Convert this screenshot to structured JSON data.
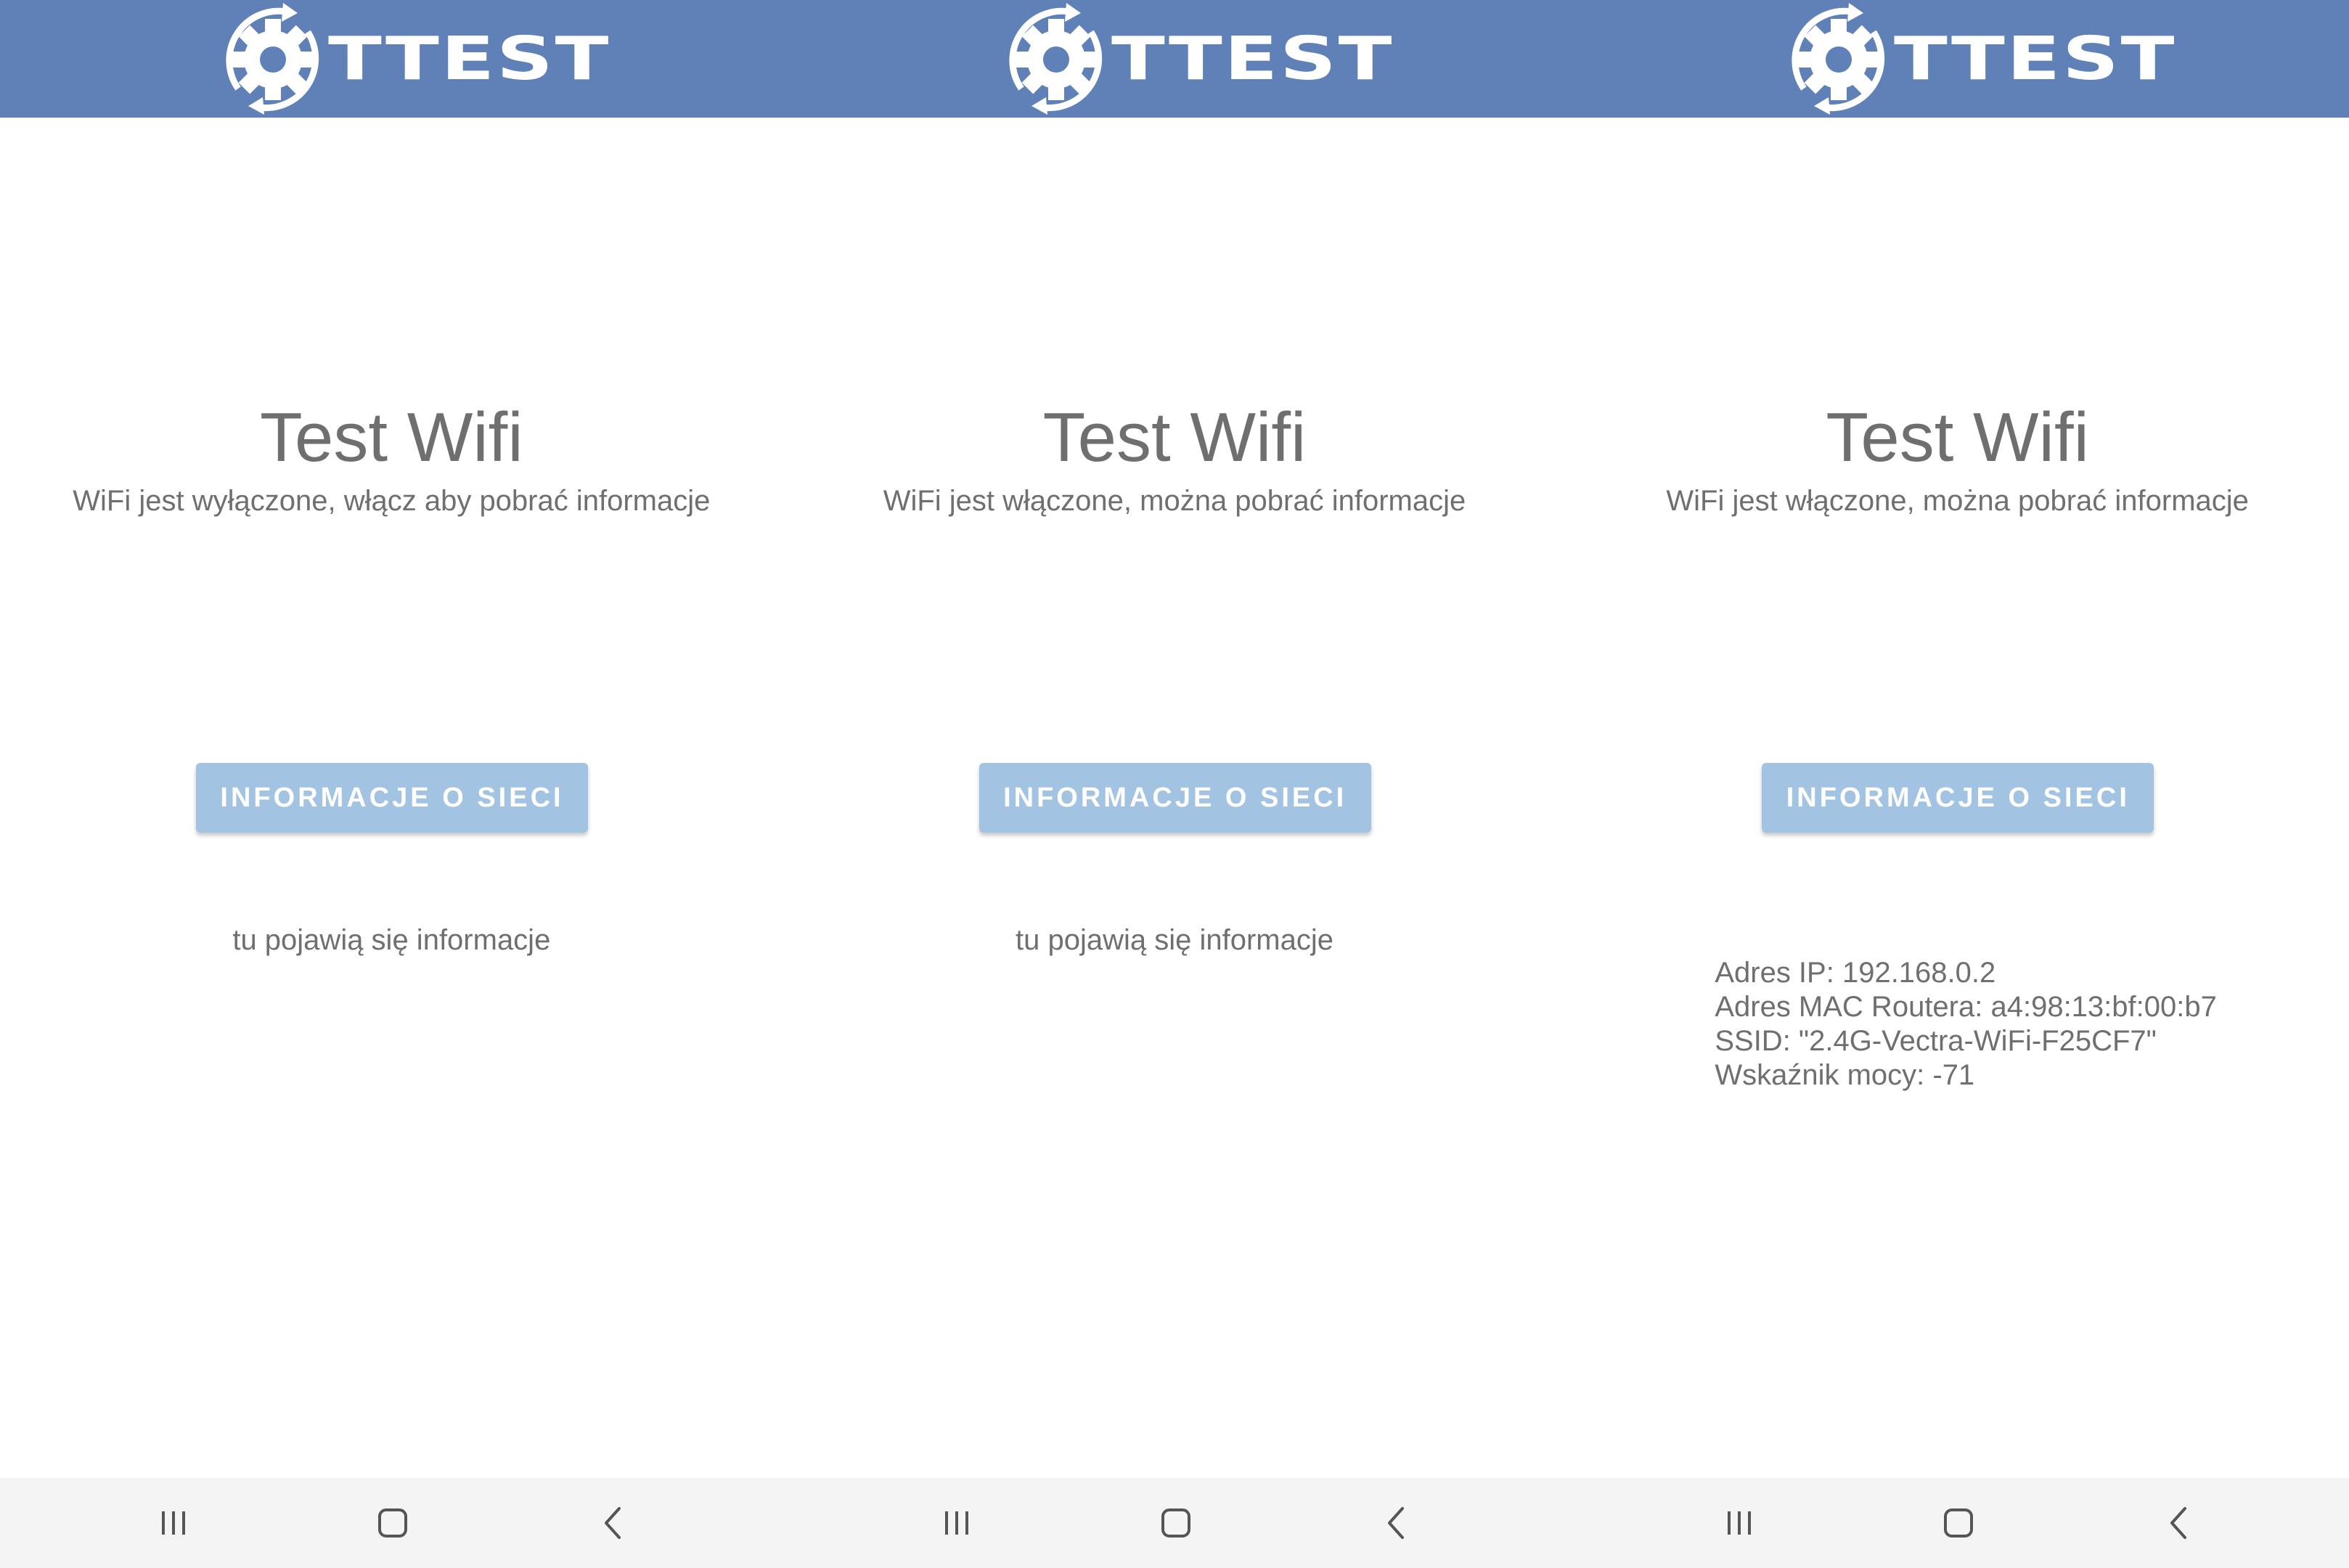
{
  "screens": [
    {
      "logo_text": "TTEST",
      "title": "Test Wifi",
      "status": "WiFi jest wyłączone, włącz aby pobrać informacje",
      "button_label": "INFORMACJE O SIECI",
      "info_placeholder": "tu pojawią się informacje"
    },
    {
      "logo_text": "TTEST",
      "title": "Test Wifi",
      "status": "WiFi jest włączone, można pobrać informacje",
      "button_label": "INFORMACJE O SIECI",
      "info_placeholder": "tu pojawią się informacje"
    },
    {
      "logo_text": "TTEST",
      "title": "Test Wifi",
      "status": "WiFi jest włączone, można pobrać informacje",
      "button_label": "INFORMACJE O SIECI",
      "info_lines": [
        "Adres IP: 192.168.0.2",
        "Adres MAC Routera: a4:98:13:bf:00:b7",
        "SSID: \"2.4G-Vectra-WiFi-F25CF7\"",
        "Wskaźnik mocy: -71"
      ]
    }
  ],
  "navbar": {
    "icons": [
      "recent-apps-icon",
      "home-icon",
      "back-icon"
    ]
  },
  "colors": {
    "header": "#5f81b7",
    "button": "#a3c3e3",
    "text": "#6f6f6f",
    "navbar": "#f4f4f4"
  }
}
